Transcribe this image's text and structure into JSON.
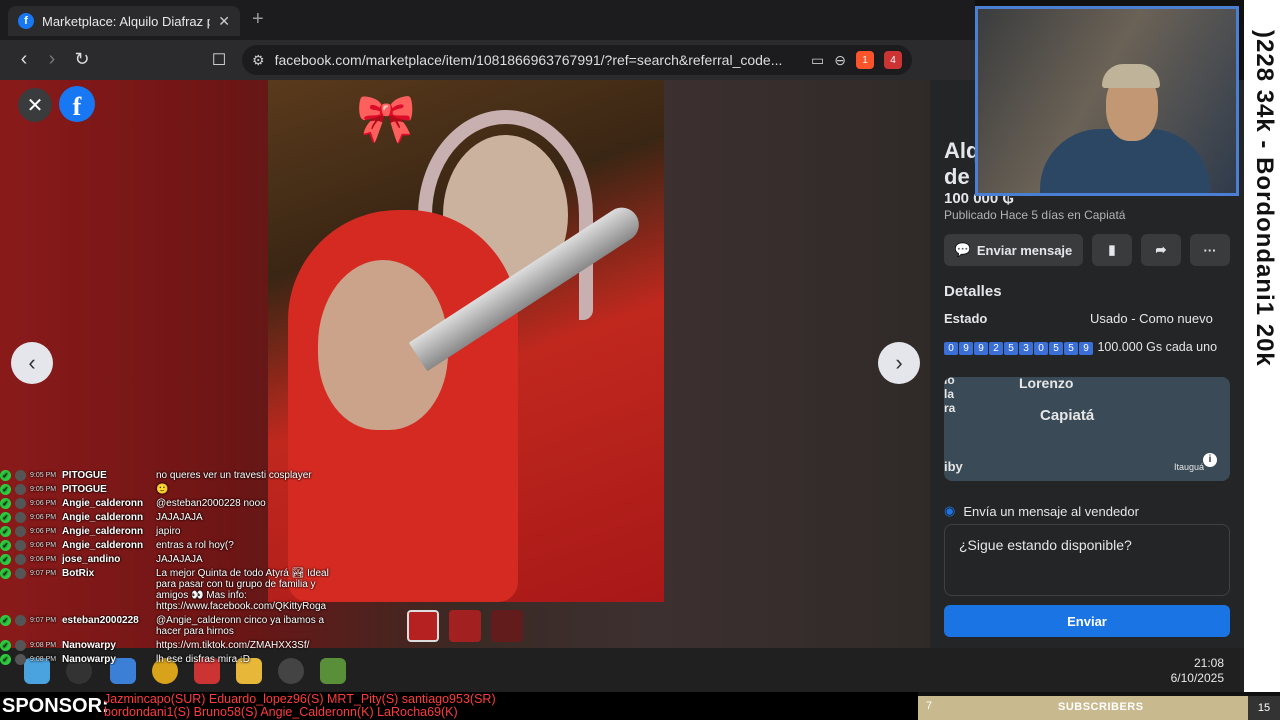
{
  "browser": {
    "tab_title": "Marketplace: Alquilo Diafraz par",
    "tab_close": "✕",
    "new_tab": "+",
    "url": "facebook.com/marketplace/item/1081866963767991/?ref=search&referral_code...",
    "extension_badge_1": "1",
    "extension_badge_2": "4"
  },
  "viewer": {
    "close": "✕",
    "prev": "‹",
    "next": "›",
    "fb_letter": "f"
  },
  "listing": {
    "title_line1": "Alq",
    "title_line2": "de",
    "price": "100 000 ₲",
    "published": "Publicado Hace 5 días en Capiatá",
    "send_message_label": "Enviar mensaje",
    "details_title": "Detalles",
    "condition_label": "Estado",
    "condition_value": "Usado - Como nuevo",
    "qty_digits": [
      "0",
      "9",
      "9",
      "2",
      "5",
      "3",
      "0",
      "5",
      "5",
      "9"
    ],
    "qty_text": "100.000 Gs cada uno",
    "map_labels": {
      "lorenzo": "Lorenzo",
      "capiata": "Capiatá",
      "itaugua": "Itauguá",
      "frag1": "io",
      "frag2": "la",
      "frag3": "ra",
      "frag4": "iby"
    },
    "message_heading": "Envía un mensaje al vendedor",
    "message_value": "¿Sigue estando disponible?",
    "send_label": "Enviar"
  },
  "stream": {
    "vertical_text": ")228 34k - Bordondani1 20k",
    "sponsor_label": "SPONSOR:",
    "sponsor_line1": "Jazmincapo(SUR) Eduardo_lopez96(S) MRT_Pity(S) santiago953(SR)",
    "sponsor_line2": "bordondani1(S) Bruno58(S) Angie_Calderonn(K) LaRocha69(K)",
    "subs_count": "7",
    "subs_label": "SUBSCRIBERS",
    "subs_goal": "15"
  },
  "taskbar": {
    "time": "21:08",
    "date": "6/10/2025"
  },
  "chat": [
    {
      "time": "9:05 PM",
      "user": "PITOGUE",
      "text": "no queres ver un travesti cosplayer"
    },
    {
      "time": "9:05 PM",
      "user": "PITOGUE",
      "text": "🙂"
    },
    {
      "time": "9:06 PM",
      "user": "Angie_calderonn",
      "text": "@esteban2000228 nooo"
    },
    {
      "time": "9:06 PM",
      "user": "Angie_calderonn",
      "text": "JAJAJAJA"
    },
    {
      "time": "9:06 PM",
      "user": "Angie_calderonn",
      "text": "japiro"
    },
    {
      "time": "9:06 PM",
      "user": "Angie_calderonn",
      "text": "entras a rol hoy(?"
    },
    {
      "time": "9:06 PM",
      "user": "jose_andino",
      "text": "JAJAJAJA"
    },
    {
      "time": "9:07 PM",
      "user": "BotRix",
      "text": "La mejor Quinta de todo Atyrá 🏞 Ideal para pasar con tu grupo de familia y amigos 👀 Mas info: https://www.facebook.com/QKittyRoga"
    },
    {
      "time": "9:07 PM",
      "user": "esteban2000228",
      "text": "@Angie_calderonn cinco ya ibamos a hacer para hirnos"
    },
    {
      "time": "9:08 PM",
      "user": "Nanowarpy",
      "text": "https://vm.tiktok.com/ZMAHXX3Sf/"
    },
    {
      "time": "9:08 PM",
      "user": "Nanowarpy",
      "text": "lh ese disfras mira :D"
    }
  ]
}
